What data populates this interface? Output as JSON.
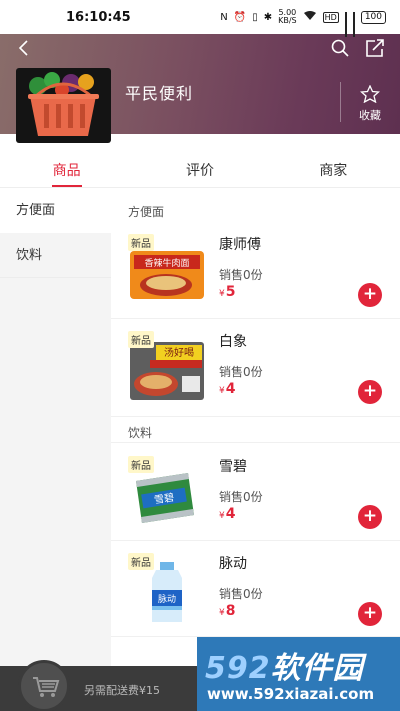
{
  "status_bar": {
    "time": "16:10:45",
    "network_speed": "5.00",
    "network_unit": "KB/S",
    "hd_label": "HD",
    "battery": "100"
  },
  "shop": {
    "name": "平民便利",
    "favorite_label": "收藏"
  },
  "tabs": [
    {
      "label": "商品",
      "active": true
    },
    {
      "label": "评价",
      "active": false
    },
    {
      "label": "商家",
      "active": false
    }
  ],
  "sidebar": {
    "items": [
      {
        "label": "方便面",
        "active": true
      },
      {
        "label": "饮料",
        "active": false
      }
    ]
  },
  "sections": [
    {
      "title": "方便面",
      "products": [
        {
          "badge": "新品",
          "name": "康师傅",
          "sold": "销售0份",
          "currency": "¥",
          "price": "5"
        },
        {
          "badge": "新品",
          "name": "白象",
          "sold": "销售0份",
          "currency": "¥",
          "price": "4"
        }
      ]
    },
    {
      "title": "饮料",
      "products": [
        {
          "badge": "新品",
          "name": "雪碧",
          "sold": "销售0份",
          "currency": "¥",
          "price": "4"
        },
        {
          "badge": "新品",
          "name": "脉动",
          "sold": "销售0份",
          "currency": "¥",
          "price": "8"
        }
      ]
    }
  ],
  "bottom_bar": {
    "delivery_text": "另需配送费¥15"
  },
  "watermark": {
    "number": "592",
    "text": "软件园",
    "url": "www.592xiazai.com"
  },
  "colors": {
    "accent": "#e1253a",
    "header_gradient_start": "#8a6e6a",
    "header_gradient_end": "#5e3050",
    "bottom_bar": "#3b3b3b",
    "watermark_bg": "#2e79b8"
  },
  "icons": {
    "back": "chevron-left-icon",
    "search": "search-icon",
    "share": "share-icon",
    "favorite": "star-icon",
    "add": "plus-icon",
    "cart": "cart-icon"
  }
}
